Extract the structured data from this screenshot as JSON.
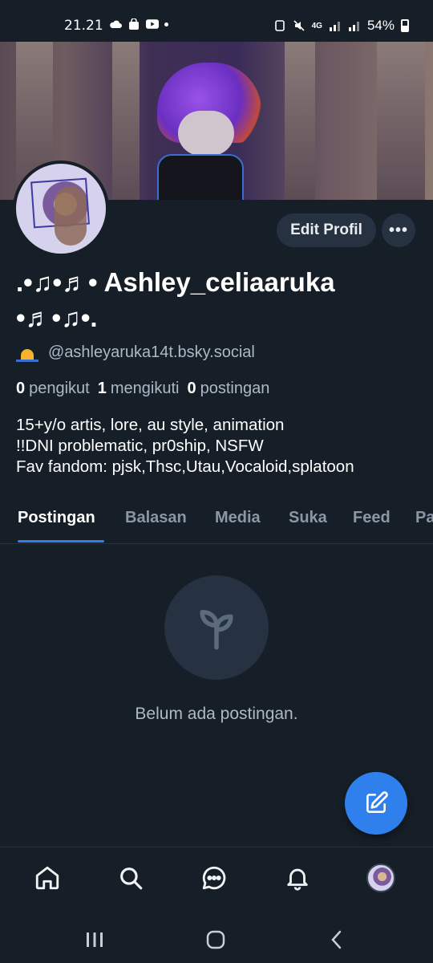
{
  "status_bar": {
    "time": "21.21",
    "battery": "54%",
    "network": "4G"
  },
  "profile": {
    "display_name": ".•♫•♬• Ashley_celiaaruka •♬•♫•.",
    "handle": "@ashleyarukа14t.bsky.social",
    "followers_count": "0",
    "followers_label": "pengikut",
    "following_count": "1",
    "following_label": "mengikuti",
    "posts_count": "0",
    "posts_label": "postingan",
    "bio": "15+y/o artis, lore, au style, animation\n!!DNI problematic, pr0ship, NSFW\nFav fandom: pjsk,Thsc,Utau,Vocaloid,splatoon"
  },
  "actions": {
    "edit_label": "Edit Profil",
    "more_label": "•••"
  },
  "tabs": [
    {
      "label": "Postingan",
      "active": true
    },
    {
      "label": "Balasan",
      "active": false
    },
    {
      "label": "Media",
      "active": false
    },
    {
      "label": "Suka",
      "active": false
    },
    {
      "label": "Feed",
      "active": false
    },
    {
      "label": "Pa",
      "active": false
    }
  ],
  "empty_state": {
    "message": "Belum ada postingan."
  },
  "bottom_nav": [
    "home-icon",
    "search-icon",
    "chat-icon",
    "bell-icon",
    "profile-avatar"
  ],
  "colors": {
    "background": "#161e27",
    "accent": "#2f80ed",
    "surface": "#263241",
    "muted_text": "#aeb9c6"
  }
}
